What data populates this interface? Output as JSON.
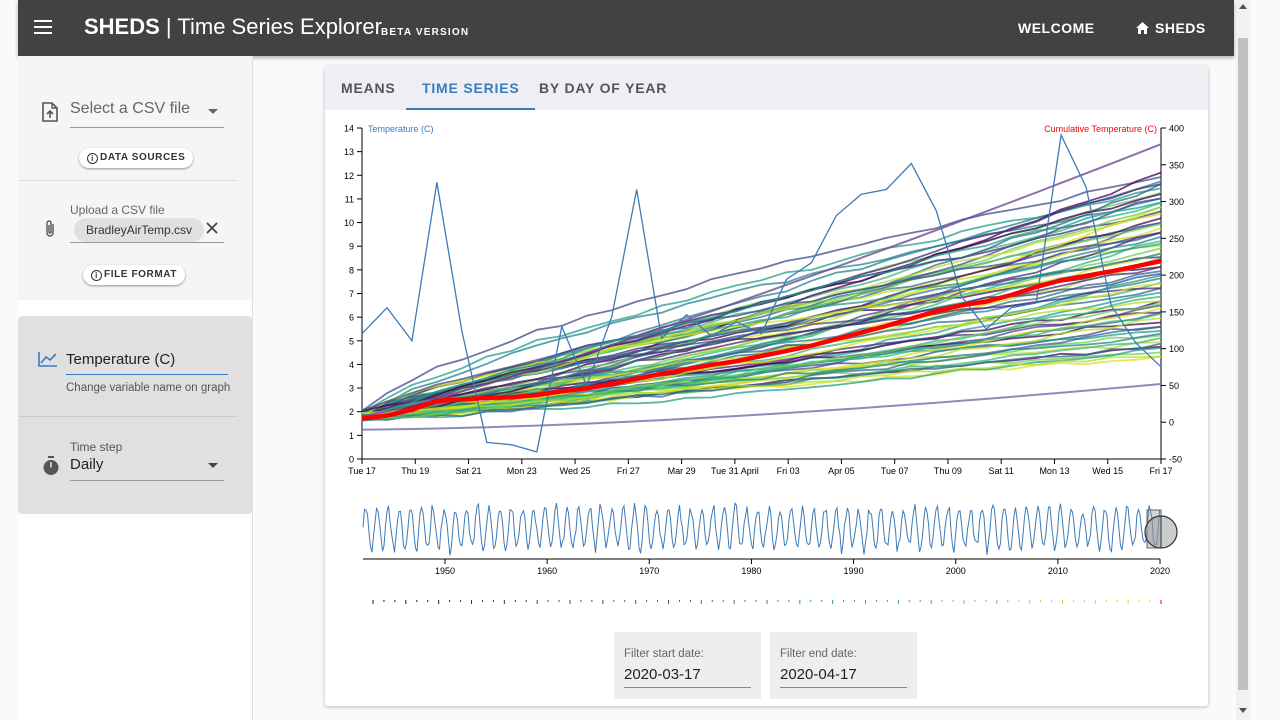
{
  "header": {
    "brand": "SHEDS",
    "separator": "|",
    "title": "Time Series Explorer",
    "beta": "BETA VERSION",
    "nav": {
      "welcome": "WELCOME",
      "sheds": "SHEDS"
    },
    "bg_color": "#424242"
  },
  "sidebar": {
    "select_csv": "Select a CSV file",
    "data_sources_btn": "DATA SOURCES",
    "upload_label": "Upload a CSV file",
    "uploaded_file": "BradleyAirTemp.csv",
    "file_format_btn": "FILE FORMAT",
    "variable_name": "Temperature (C)",
    "variable_help": "Change variable name on graph",
    "time_step_label": "Time step",
    "time_step_value": "Daily"
  },
  "tabs": [
    {
      "label": "MEANS",
      "active": false
    },
    {
      "label": "TIME SERIES",
      "active": true
    },
    {
      "label": "BY DAY OF YEAR",
      "active": false
    }
  ],
  "filters": {
    "start_label": "Filter start date:",
    "start_value": "2020-03-17",
    "end_label": "Filter end date:",
    "end_value": "2020-04-17"
  },
  "colors": {
    "accent": "#3b7cbf",
    "cumulative": "#ff0000",
    "series": "#3d7ab8"
  },
  "chart_data": [
    {
      "type": "line",
      "left_axis_label": "Temperature (C)",
      "right_axis_label": "Cumulative Temperature (C)",
      "x_ticks": [
        "Tue 17",
        "Thu 19",
        "Sat 21",
        "Mon 23",
        "Wed 25",
        "Fri 27",
        "Mar 29",
        "Tue 31 April",
        "Fri 03",
        "Apr 05",
        "Tue 07",
        "Thu 09",
        "Sat 11",
        "Mon 13",
        "Wed 15",
        "Fri 17"
      ],
      "y_left_range": [
        0,
        14
      ],
      "y_left_ticks": [
        0,
        1,
        2,
        3,
        4,
        5,
        6,
        7,
        8,
        9,
        10,
        11,
        12,
        13,
        14
      ],
      "y_right_range": [
        -50,
        400
      ],
      "y_right_ticks": [
        -50,
        0,
        50,
        100,
        150,
        200,
        250,
        300,
        350,
        400
      ],
      "temperature_series": {
        "name": "Temperature (C)",
        "values": [
          5.3,
          6.4,
          5.0,
          11.7,
          5.4,
          0.7,
          0.6,
          0.3,
          5.6,
          3.1,
          6.0,
          11.4,
          5.1,
          6.1,
          5.2,
          5.8,
          5.3,
          7.6,
          8.3,
          10.3,
          11.2,
          11.4,
          12.5,
          10.5,
          6.9,
          5.5,
          6.4,
          6.6,
          13.7,
          11.5,
          6.5,
          4.9,
          3.9
        ]
      },
      "cumulative_current": {
        "name": "Cumulative Temperature (C)",
        "values": [
          5,
          9,
          17,
          29,
          31,
          33,
          34,
          37,
          42,
          46,
          52,
          59,
          66,
          72,
          78,
          83,
          90,
          97,
          104,
          113,
          122,
          131,
          141,
          151,
          159,
          164,
          173,
          184,
          193,
          199,
          205,
          212,
          219
        ]
      },
      "cumulative_previous_years_count": 70
    },
    {
      "type": "line",
      "name": "full-record-brush",
      "x_ticks": [
        "1950",
        "1960",
        "1970",
        "1980",
        "1990",
        "2000",
        "2010",
        "2020"
      ]
    }
  ]
}
